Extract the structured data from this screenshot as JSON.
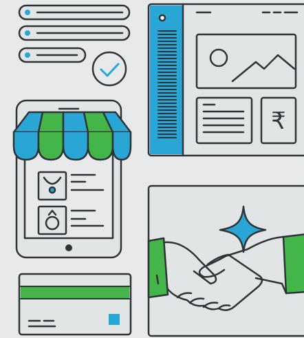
{
  "colors": {
    "background": "#e7e9ea",
    "outline": "#2e3338",
    "blue": "#2aa6d6",
    "green": "#44b649",
    "panel": "#e2e5e6"
  },
  "icons": {
    "checklist": [
      "list-row-icon",
      "list-row-icon",
      "list-row-icon",
      "check-circle-icon"
    ],
    "browser": [
      "browser-window-icon",
      "image-placeholder-icon",
      "text-block-icon"
    ],
    "shop": [
      "storefront-awning-icon",
      "tablet-icon",
      "necklace-icon",
      "ring-icon"
    ],
    "card": "credit-card-icon",
    "deal": [
      "handshake-icon",
      "sparkle-icon"
    ]
  },
  "currency": {
    "symbol": "₹"
  }
}
